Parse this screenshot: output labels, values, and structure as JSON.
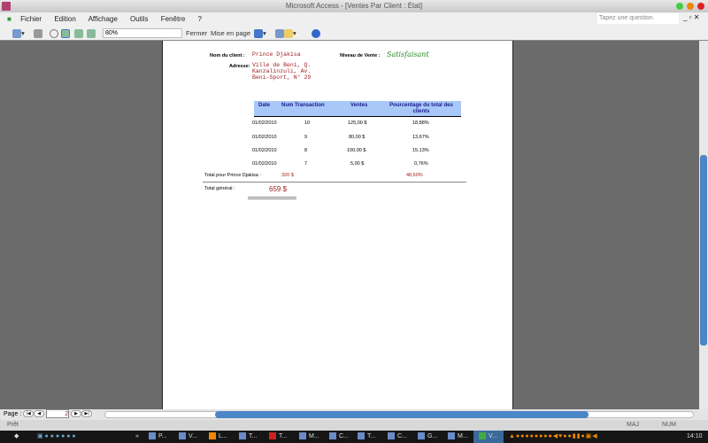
{
  "window": {
    "title": "Microsoft Access - [Ventes Par Client : État]"
  },
  "menu": [
    "Fichier",
    "Edition",
    "Affichage",
    "Outils",
    "Fenêtre",
    "?"
  ],
  "toolbar": {
    "zoom": "80%",
    "close": "Fermer",
    "page_setup": "Mise en page"
  },
  "help": {
    "placeholder": "Tapez une question"
  },
  "report": {
    "client_label": "Nom du client :",
    "client": "Prince Djakisa",
    "level_label": "Niveau de Vente :",
    "level": "Satisfaisant",
    "address_label": "Adresse:",
    "address": [
      "Ville de Beni, Q.",
      "Kanzalinzuli, Av.",
      "Beni-Sport, N° 29"
    ],
    "headers": [
      "Date",
      "Num Transaction",
      "Ventes",
      "Pourcentage du total des clients"
    ],
    "rows": [
      {
        "date": "01/02/2010",
        "num": "10",
        "ventes": "125,00 $",
        "pct": "18,88%"
      },
      {
        "date": "01/02/2010",
        "num": "9",
        "ventes": "80,00 $",
        "pct": "13,67%"
      },
      {
        "date": "01/02/2010",
        "num": "8",
        "ventes": "100,00 $",
        "pct": "15,13%"
      },
      {
        "date": "01/02/2010",
        "num": "7",
        "ventes": "5,00 $",
        "pct": "0,76%"
      }
    ],
    "subtotal_label": "Total pour Prince Djakisa :",
    "subtotal": "320 $",
    "subtotal_pct": "48,60%",
    "grand_label": "Total général :",
    "grand": "659 $"
  },
  "nav": {
    "label": "Page :",
    "page": "2"
  },
  "status": {
    "left": "Prêt",
    "caps": "MAJ",
    "num": "NUM"
  },
  "taskbar": {
    "items": [
      "P...",
      "V...",
      "L...",
      "T...",
      "T...",
      "M...",
      "C...",
      "T...",
      "C...",
      "G...",
      "M...",
      "V..."
    ],
    "clock": "14:10"
  }
}
